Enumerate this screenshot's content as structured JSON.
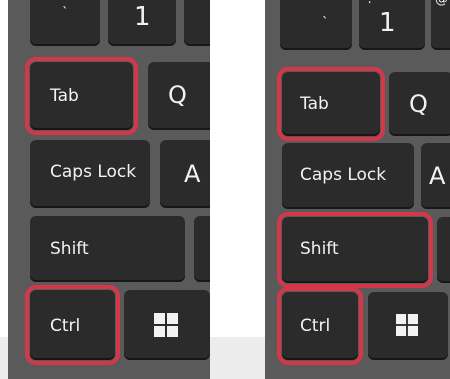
{
  "colors": {
    "key_face": "#2b2b2b",
    "key_label": "#f2f2f2",
    "highlight": "#d6364a",
    "led": "#8fd14f",
    "panel": "#5a5a5a"
  },
  "left_keyboard": {
    "keys": {
      "backtick": "`",
      "one": "1",
      "tab": "Tab",
      "q": "Q",
      "caps_lock": "Caps Lock",
      "a": "A",
      "shift": "Shift",
      "ctrl": "Ctrl",
      "windows": "windows-icon"
    },
    "highlighted": [
      "Tab",
      "Ctrl"
    ]
  },
  "right_keyboard": {
    "keys": {
      "tilde": "~",
      "backtick": "`",
      "exclaim": "!",
      "one": "1",
      "at": "@",
      "tab": "Tab",
      "q": "Q",
      "caps_lock": "Caps Lock",
      "a": "A",
      "shift": "Shift",
      "ctrl": "Ctrl",
      "windows": "windows-icon"
    },
    "highlighted": [
      "Shift",
      "Ctrl"
    ]
  }
}
